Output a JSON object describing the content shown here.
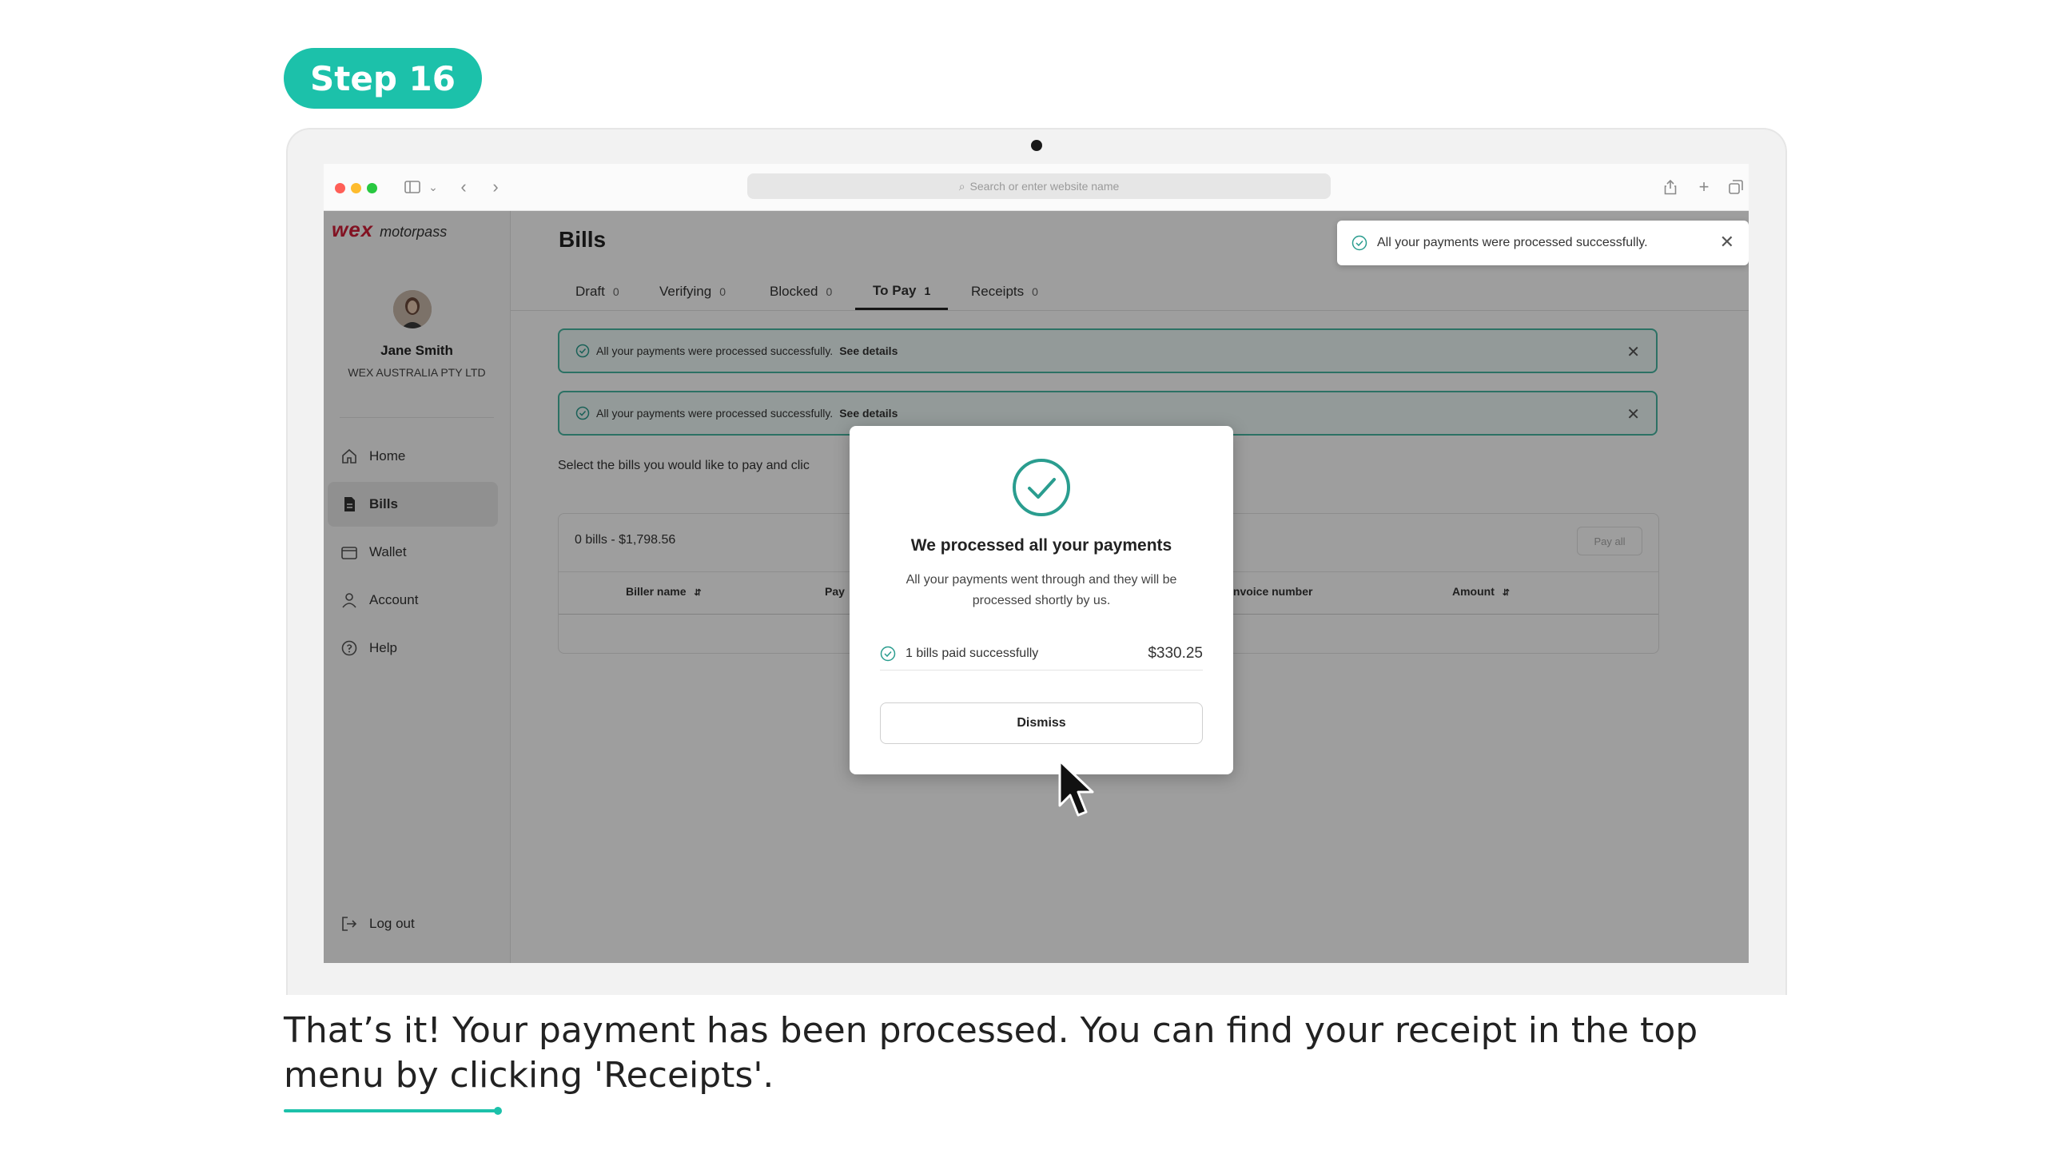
{
  "step": {
    "label": "Step 16"
  },
  "browser": {
    "url_placeholder": "Search or enter website name"
  },
  "brand": {
    "name": "wex",
    "product": "motorpass"
  },
  "user": {
    "name": "Jane Smith",
    "company": "WEX AUSTRALIA PTY LTD"
  },
  "nav": {
    "items": [
      {
        "label": "Home",
        "icon": "home-icon"
      },
      {
        "label": "Bills",
        "icon": "document-icon"
      },
      {
        "label": "Wallet",
        "icon": "wallet-icon"
      },
      {
        "label": "Account",
        "icon": "user-icon"
      },
      {
        "label": "Help",
        "icon": "help-icon"
      }
    ],
    "active": "Bills",
    "logout": "Log out"
  },
  "page": {
    "title": "Bills"
  },
  "tabs": [
    {
      "label": "Draft",
      "count": "0"
    },
    {
      "label": "Verifying",
      "count": "0"
    },
    {
      "label": "Blocked",
      "count": "0"
    },
    {
      "label": "To Pay",
      "count": "1"
    },
    {
      "label": "Receipts",
      "count": "0"
    }
  ],
  "banners": [
    {
      "text": "All your payments were processed successfully.",
      "link": "See details"
    },
    {
      "text": "All your payments were processed successfully.",
      "link": "See details"
    }
  ],
  "instruction": "Select the bills you would like to pay and clic",
  "table": {
    "summary": "0 bills - $1,798.56",
    "pay_all": "Pay all",
    "columns": [
      "Biller name",
      "Pay",
      "Invoice number",
      "Amount"
    ]
  },
  "toast": {
    "text": "All your payments were processed successfully."
  },
  "modal": {
    "title": "We processed all your payments",
    "text": "All your payments went through and they will be processed shortly by us.",
    "row_label": "1 bills paid successfully",
    "row_amount": "$330.25",
    "dismiss": "Dismiss"
  },
  "caption": "That’s it! Your payment has been processed. You can find your receipt in the top menu by clicking 'Receipts'.",
  "colors": {
    "accent": "#1cc1aa",
    "success": "#2a9d8f",
    "brand": "#d21e37"
  }
}
